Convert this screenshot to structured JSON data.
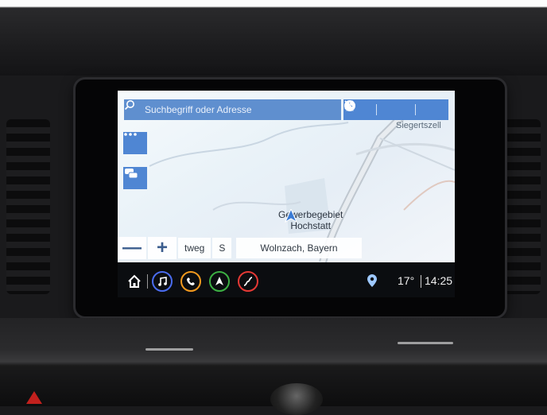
{
  "search": {
    "placeholder": "Suchbegriff oder Adresse"
  },
  "top_actions": [
    "star-icon",
    "clock-icon",
    "close-icon"
  ],
  "map": {
    "place_label": "Siegertszell",
    "poi_label_line1": "Gewerbegebiet",
    "poi_label_line2": "Hochstatt",
    "side_buttons": [
      "more-icon",
      "traffic-icon"
    ]
  },
  "map_controls": {
    "zoom_out": "—",
    "zoom_in": "+",
    "road_label": "tweg",
    "direction_label": "S",
    "location_label": "Wolnzach, Bayern"
  },
  "taskbar": {
    "items": [
      "home-icon",
      "music-icon",
      "phone-icon",
      "navigation-icon",
      "connectivity-icon"
    ],
    "item_colors": [
      "#ffffff",
      "#4a6cf0",
      "#f39a1e",
      "#3cb043",
      "#e53935"
    ],
    "temperature": "17°",
    "time": "14:25"
  }
}
